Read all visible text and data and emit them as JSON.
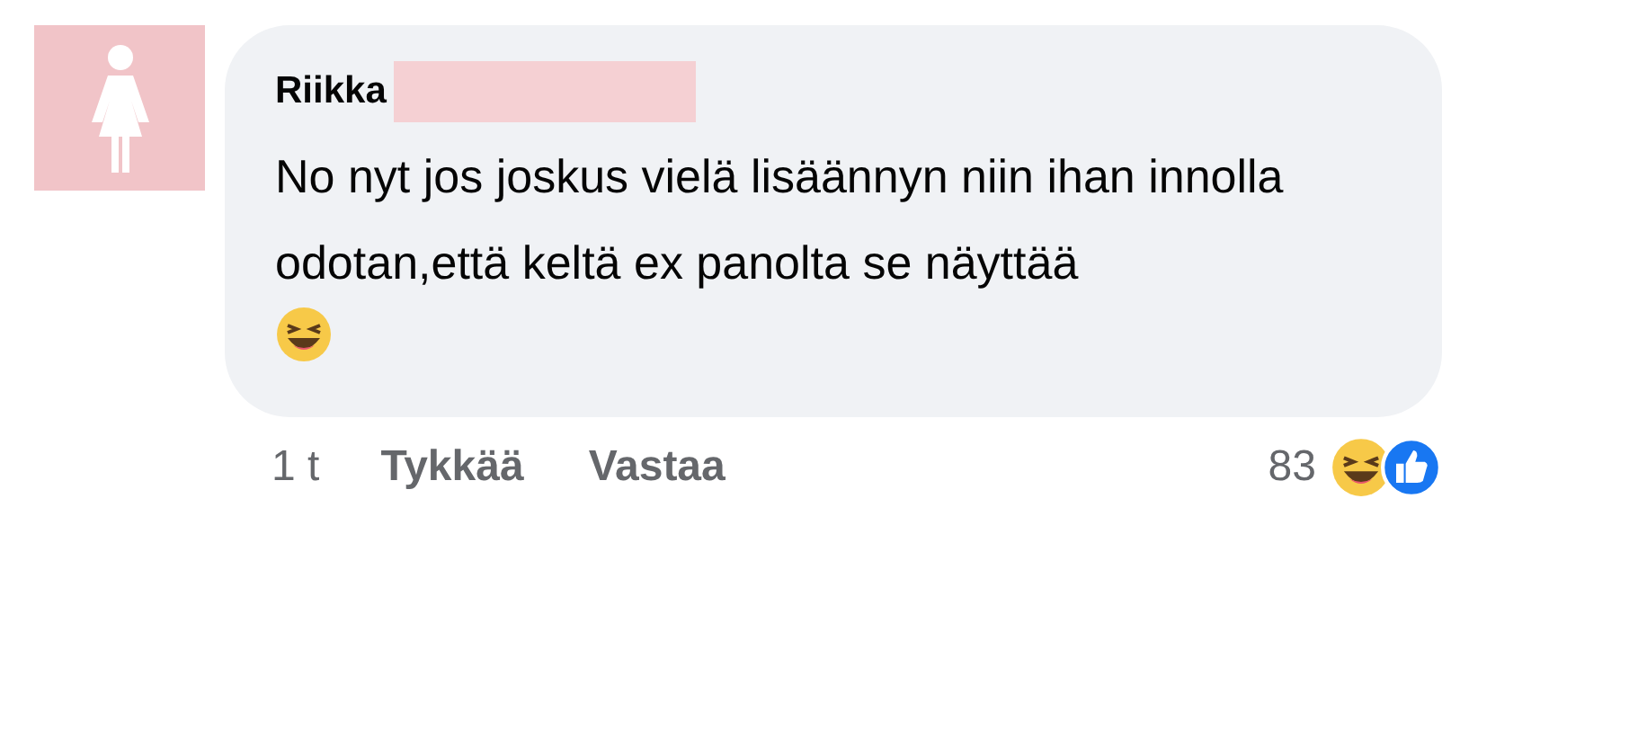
{
  "comment": {
    "author": "Riikka",
    "text": "No nyt jos joskus vielä lisäännyn niin ihan innolla odotan,että keltä ex panolta se näyttää",
    "time": "1 t",
    "actions": [
      "Tykkää",
      "Vastaa"
    ],
    "reaction_count": "83"
  }
}
